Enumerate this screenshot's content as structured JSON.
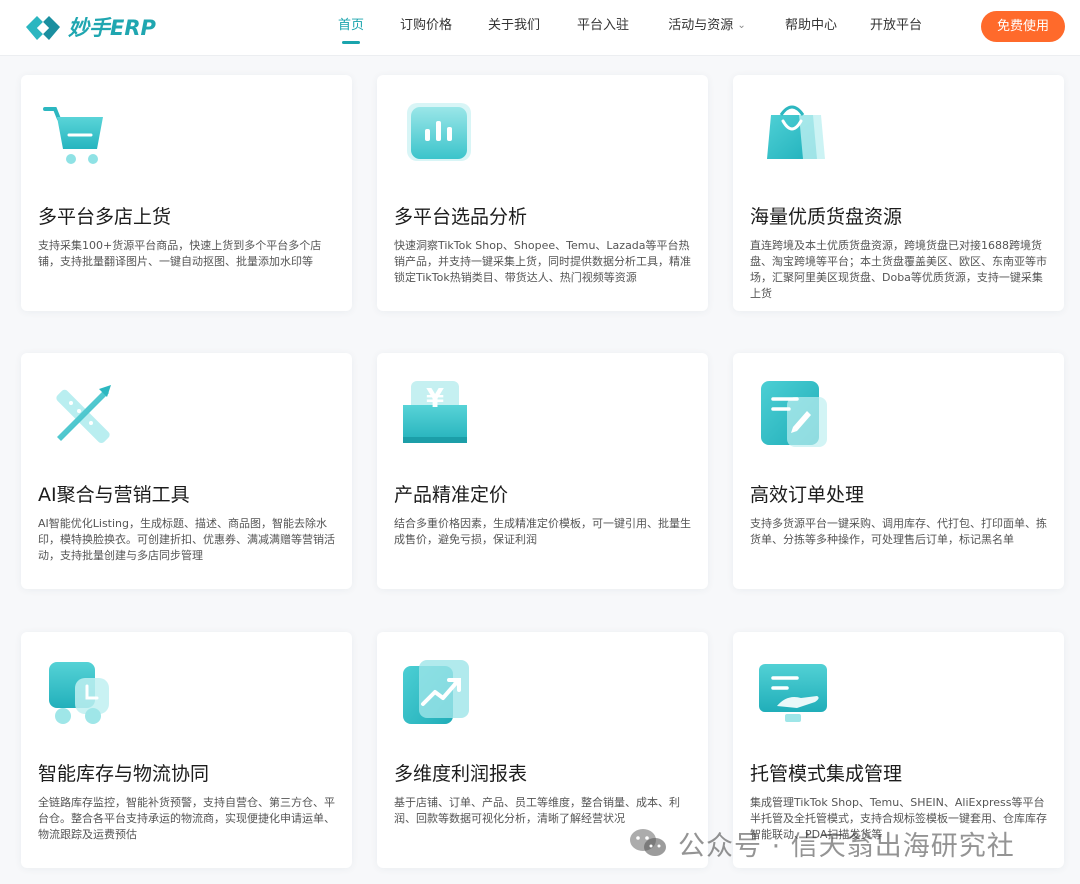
{
  "brand": {
    "name": "妙手ERP"
  },
  "nav": {
    "items": [
      {
        "label": "首页",
        "active": true
      },
      {
        "label": "订购价格"
      },
      {
        "label": "关于我们"
      },
      {
        "label": "平台入驻"
      },
      {
        "label": "活动与资源",
        "dropdown": true
      },
      {
        "label": "帮助中心"
      },
      {
        "label": "开放平台"
      }
    ],
    "cta": "免费使用"
  },
  "colors": {
    "accent": "#1aa4ad",
    "cta": "#ff6a2b",
    "icon_teal": "#3ec9cf"
  },
  "features": [
    {
      "icon": "cart-icon",
      "title": "多平台多店上货",
      "desc": "支持采集100+货源平台商品，快速上货到多个平台多个店铺，支持批量翻译图片、一键自动抠图、批量添加水印等"
    },
    {
      "icon": "bar-chart-icon",
      "title": "多平台选品分析",
      "desc": "快速洞察TikTok Shop、Shopee、Temu、Lazada等平台热销产品，并支持一键采集上货，同时提供数据分析工具，精准锁定TikTok热销类目、带货达人、热门视频等资源"
    },
    {
      "icon": "shopping-bag-icon",
      "title": "海量优质货盘资源",
      "desc": "直连跨境及本土优质货盘资源，跨境货盘已对接1688跨境货盘、淘宝跨境等平台；本土货盘覆盖美区、欧区、东南亚等市场，汇聚阿里美区现货盘、Doba等优质货源，支持一键采集上货"
    },
    {
      "icon": "tools-icon",
      "title": "AI聚合与营销工具",
      "desc": "AI智能优化Listing，生成标题、描述、商品图，智能去除水印，模特换脸换衣。可创建折扣、优惠券、满减满赠等营销活动，支持批量创建与多店同步管理"
    },
    {
      "icon": "yen-wallet-icon",
      "title": "产品精准定价",
      "desc": "结合多重价格因素，生成精准定价模板，可一键引用、批量生成售价，避免亏损，保证利润"
    },
    {
      "icon": "order-edit-icon",
      "title": "高效订单处理",
      "desc": "支持多货源平台一键采购、调用库存、代打包、打印面单、拣货单、分拣等多种操作，可处理售后订单，标记黑名单"
    },
    {
      "icon": "truck-icon",
      "title": "智能库存与物流协同",
      "desc": "全链路库存监控，智能补货预警，支持自营仓、第三方仓、平台仓。整合各平台支持承运的物流商，实现便捷化申请运单、物流跟踪及运费预估"
    },
    {
      "icon": "trend-report-icon",
      "title": "多维度利润报表",
      "desc": "基于店铺、订单、产品、员工等维度，整合销量、成本、利润、回款等数据可视化分析，清晰了解经营状况"
    },
    {
      "icon": "hand-screen-icon",
      "title": "托管模式集成管理",
      "desc": "集成管理TikTok Shop、Temu、SHEIN、AliExpress等平台半托管及全托管模式，支持合规标签模板一键套用、仓库库存智能联动、PDA扫描发货等"
    }
  ],
  "watermark": {
    "text": "公众号 · 信天翁出海研究社"
  }
}
